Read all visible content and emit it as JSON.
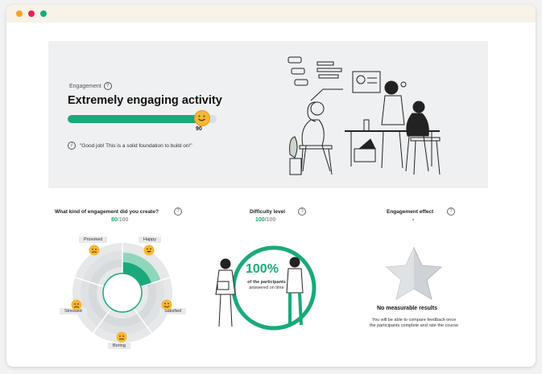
{
  "window_dots": [
    "#f5a623",
    "#e0245e",
    "#1aa97b"
  ],
  "hero": {
    "label": "Engagement",
    "title": "Extremely engaging activity",
    "score": "90",
    "score_fraction": 0.9,
    "note": "\"Good job! This is a solid foundation to build on!\""
  },
  "engagement_kind": {
    "title": "What kind of engagement did you create?",
    "value": "80",
    "total": "/100",
    "labels": {
      "provoked": "Provoked",
      "happy": "Happy",
      "satisfied": "Satisfied",
      "boring": "Boring",
      "stressed": "Stressed"
    }
  },
  "difficulty": {
    "title": "Difficulty level",
    "value": "100",
    "total": "/100",
    "percent": "100%",
    "sub1": "of the participants",
    "sub2": "answered on time"
  },
  "effect": {
    "title": "Engagement effect",
    "value": "-",
    "result_title": "No measurable results",
    "result_line1": "You will be able to compare feedback once",
    "result_line2": "the participants complete and rate the course"
  },
  "colors": {
    "accent": "#1aa97b",
    "smiley": "#f7b733"
  }
}
